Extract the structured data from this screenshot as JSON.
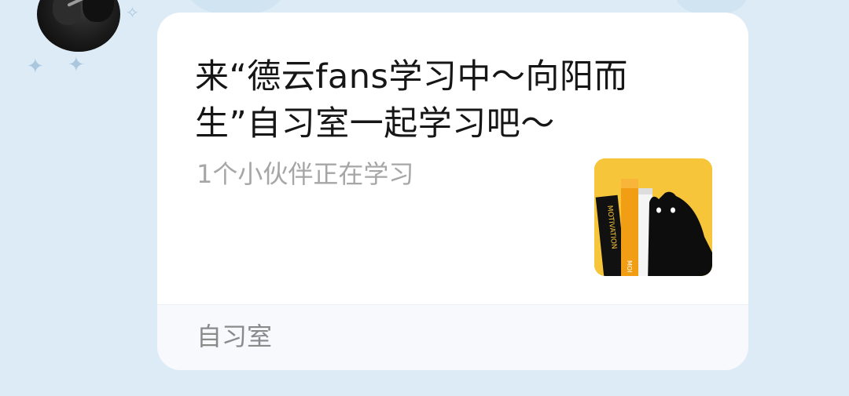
{
  "message": {
    "title": "来“德云fans学习中～向阳而生”自习室一起学习吧～",
    "subtitle": "1个小伙伴正在学习",
    "footer_label": "自习室"
  },
  "thumbnail": {
    "icon": "study-room-books-cat-icon",
    "background_color": "#f6c53a",
    "book_spine_texts": [
      "MOTIVATION",
      "MOI"
    ]
  },
  "avatar": {
    "icon": "user-avatar"
  },
  "colors": {
    "page_background": "#dcebf5",
    "card_background": "#ffffff",
    "footer_background": "#f7f9fd",
    "title_text": "#161616",
    "subtitle_text": "#a6a6a6",
    "footer_text": "#8a8a8a"
  }
}
